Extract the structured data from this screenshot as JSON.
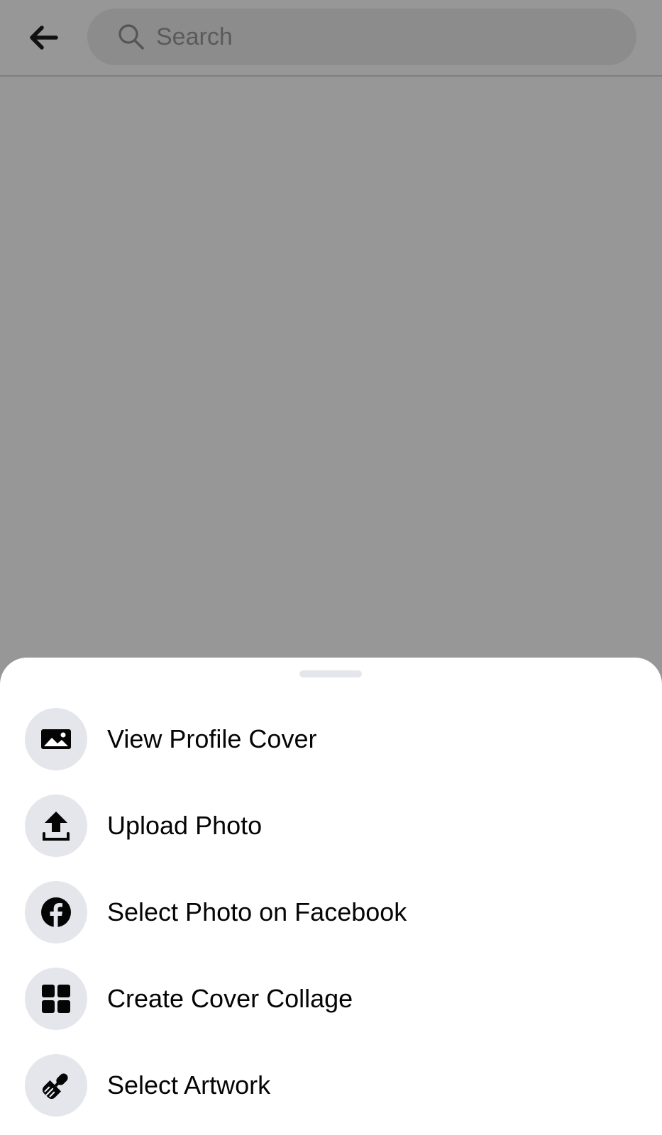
{
  "header": {
    "search_placeholder": "Search"
  },
  "menu": {
    "items": [
      {
        "label": "View Profile Cover",
        "icon": "photo-icon"
      },
      {
        "label": "Upload Photo",
        "icon": "upload-icon"
      },
      {
        "label": "Select Photo on Facebook",
        "icon": "facebook-icon"
      },
      {
        "label": "Create Cover Collage",
        "icon": "grid-icon"
      },
      {
        "label": "Select Artwork",
        "icon": "paintbrush-icon"
      }
    ]
  },
  "colors": {
    "overlay": "#979797",
    "icon_circle": "#e4e6eb",
    "text": "#050505",
    "sheet": "#ffffff"
  }
}
